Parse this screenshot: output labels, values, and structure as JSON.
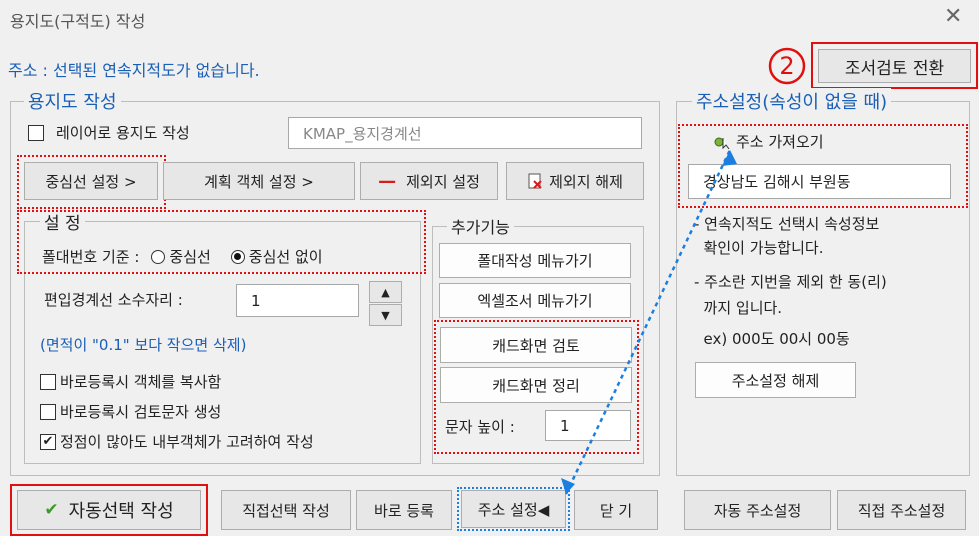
{
  "window": {
    "title": "용지도(구적도) 작성",
    "close_glyph": "✕"
  },
  "status_text": "주소 : 선택된 연속지적도가 없습니다.",
  "top_right": {
    "marker": "2",
    "toggle_button": "조서검토 전환"
  },
  "drawing_group": {
    "legend": "용지도 작성",
    "layer_checkbox_label": "레이어로 용지도 작성",
    "layer_checked": false,
    "layer_input_value": "KMAP_용지경계선",
    "buttons": {
      "center_line": "중심선 설정 >",
      "plan_object": "계획 객체 설정 >",
      "exclude_set": "제외지 설정",
      "exclude_unset": "제외지 해제"
    },
    "settings": {
      "legend": "설   정",
      "pole_label": "폴대번호 기준 :",
      "radio_center": "중심선",
      "radio_no_center": "중심선 없이",
      "selected": "중심선 없이",
      "decimal_label": "편입경계선 소수자리 :",
      "decimal_value": "1",
      "note": "(면적이 \"0.1\" 보다 작으면 삭제)",
      "checks": [
        {
          "label": "바로등록시 객체를 복사함",
          "checked": false
        },
        {
          "label": "바로등록시 검토문자 생성",
          "checked": false
        },
        {
          "label": "정점이 많아도 내부객체가 고려하여 작성",
          "checked": true
        }
      ]
    },
    "extra": {
      "legend": "추가기능",
      "pole_menu": "폴대작성 메뉴가기",
      "excel_menu": "엑셀조서 메뉴가기",
      "cad_review": "캐드화면 검토",
      "cad_clean": "캐드화면 정리",
      "text_height_label": "문자 높이 :",
      "text_height_value": "1"
    }
  },
  "address_group": {
    "legend": "주소설정(속성이 없을 때)",
    "fetch_label": "주소 가져오기",
    "address_value": "경상남도 김해시 부원동",
    "info_lines": [
      "- 연속지적도 선택시 속성정보",
      "  확인이 가능합니다.",
      "- 주소란 지번을 제외 한 동(리)",
      "  까지 입니다.",
      "  ex) 000도 00시 00동"
    ],
    "clear_button": "주소설정 해제"
  },
  "bottom": {
    "auto_select": "자동선택 작성",
    "manual_select": "직접선택 작성",
    "direct_register": "바로 등록",
    "address_setting": "주소 설정◀",
    "close": "닫   기",
    "auto_address": "자동 주소설정",
    "manual_address": "직접 주소설정"
  },
  "colors": {
    "accent": "#1a5fb4",
    "highlight_red": "#e01010",
    "highlight_blue": "#1a7fe0"
  }
}
